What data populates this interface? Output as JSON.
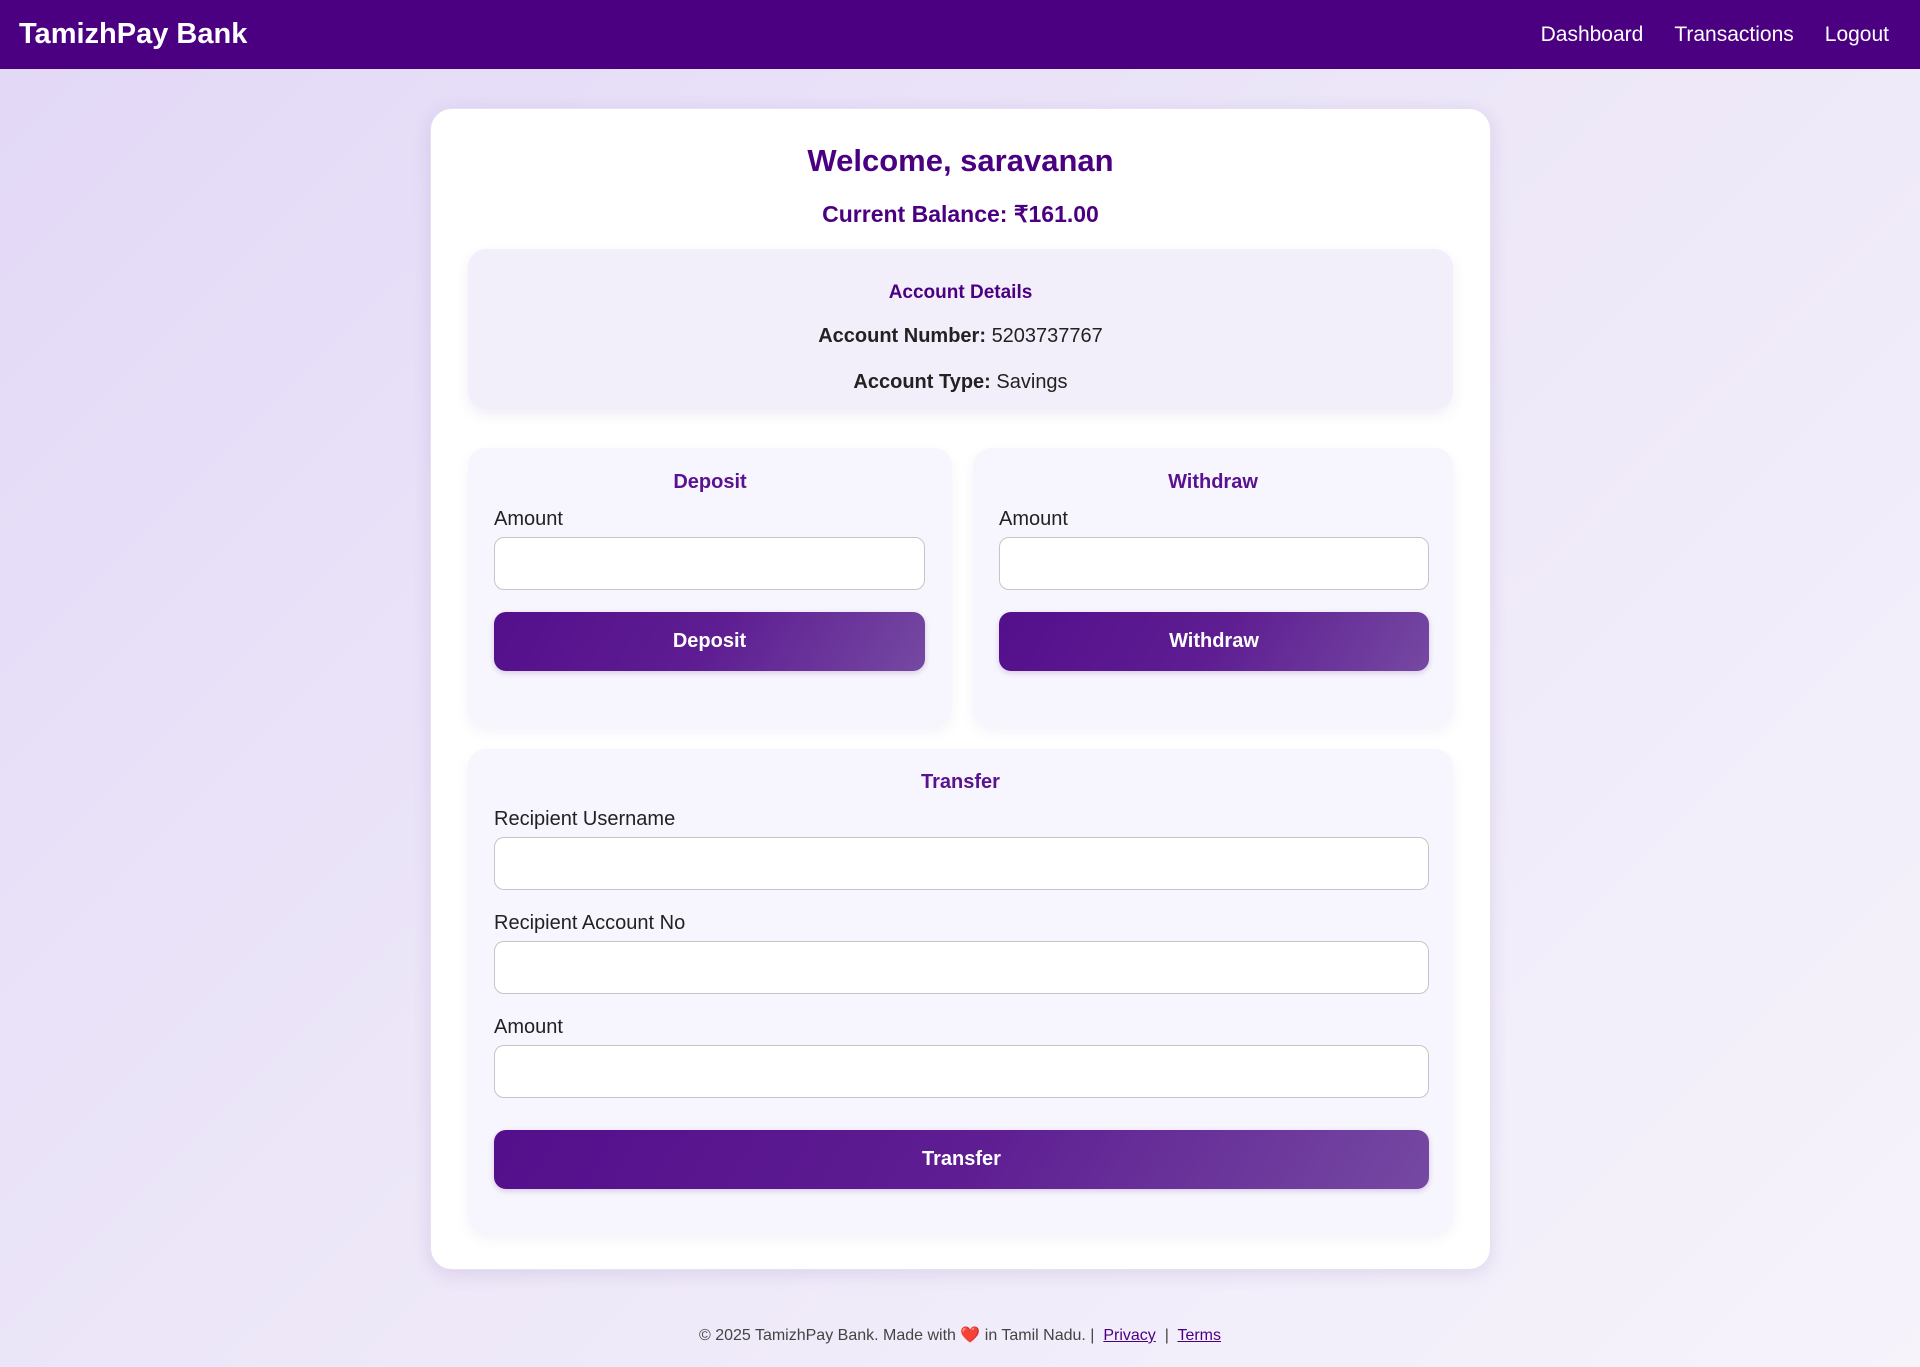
{
  "navbar": {
    "brand": "TamizhPay Bank",
    "links": [
      "Dashboard",
      "Transactions",
      "Logout"
    ]
  },
  "main": {
    "welcome": "Welcome, saravanan",
    "balance": "Current Balance: ₹161.00",
    "account_details": {
      "title": "Account Details",
      "number_label": "Account Number:",
      "number_value": "5203737767",
      "type_label": "Account Type:",
      "type_value": "Savings"
    },
    "deposit": {
      "title": "Deposit",
      "amount_label": "Amount",
      "amount_value": "",
      "button": "Deposit"
    },
    "withdraw": {
      "title": "Withdraw",
      "amount_label": "Amount",
      "amount_value": "",
      "button": "Withdraw"
    },
    "transfer": {
      "title": "Transfer",
      "recipient_username_label": "Recipient Username",
      "recipient_username_value": "",
      "recipient_account_label": "Recipient Account No",
      "recipient_account_value": "",
      "amount_label": "Amount",
      "amount_value": "",
      "button": "Transfer"
    }
  },
  "footer": {
    "prefix": "© 2025 TamizhPay Bank. Made with",
    "heart": "❤️",
    "suffix": "in Tamil Nadu. |",
    "privacy": "Privacy",
    "separator": "|",
    "terms": "Terms"
  },
  "colors": {
    "navbar": "#4b0082",
    "accent": "#4b0082",
    "button_start": "#540f8c",
    "button_end": "#7549a2"
  }
}
